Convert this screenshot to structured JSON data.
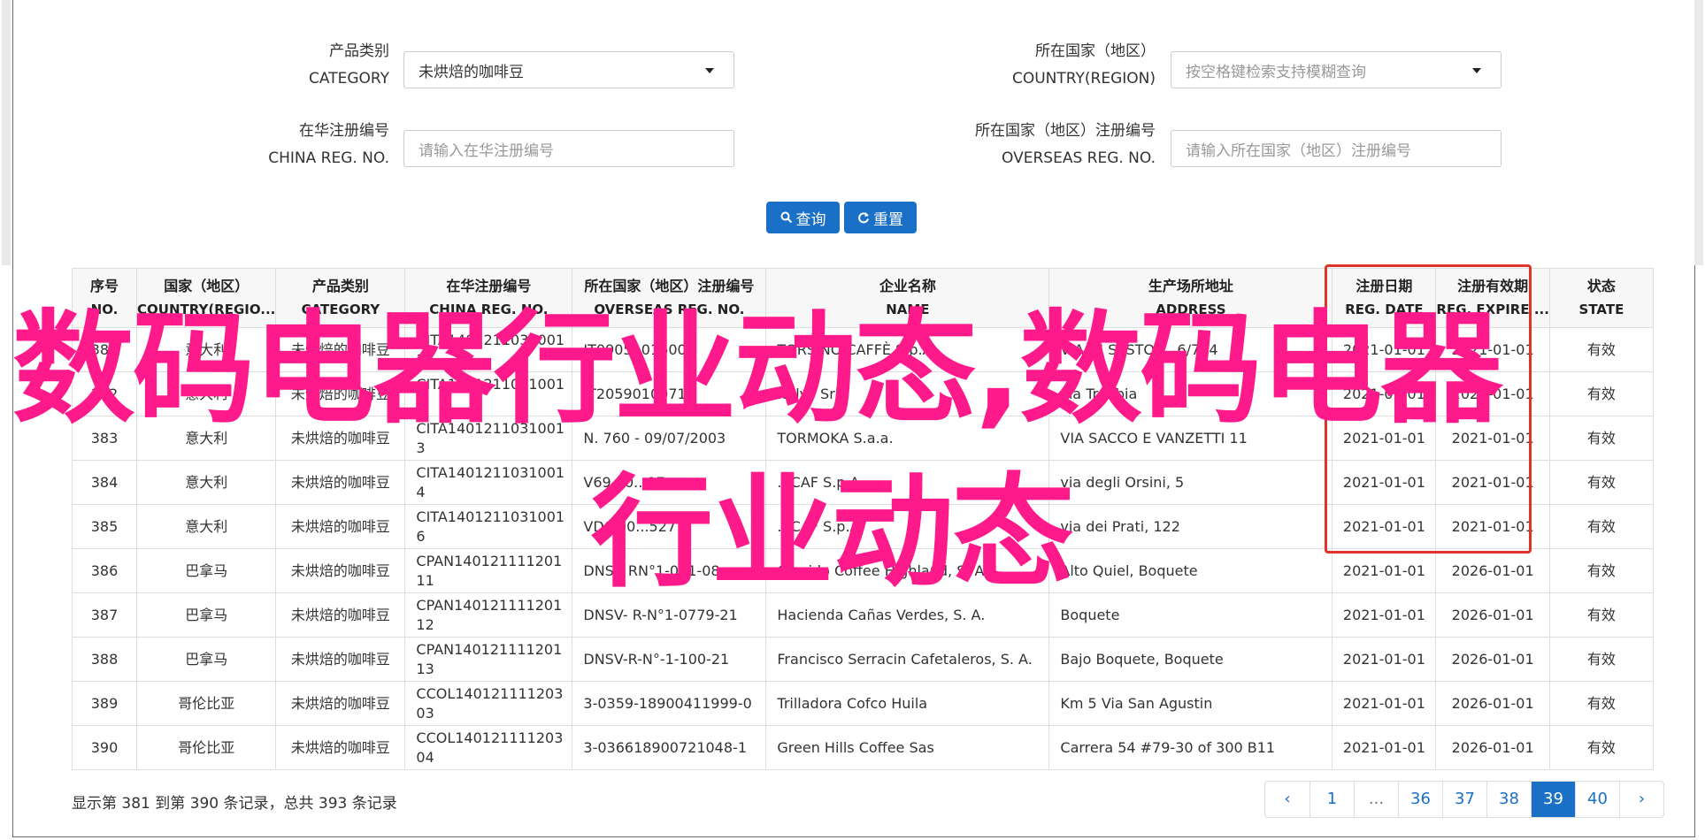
{
  "filters": {
    "category_label_cn": "产品类别",
    "category_label_en": "CATEGORY",
    "category_value": "未烘焙的咖啡豆",
    "country_label_cn": "所在国家（地区）",
    "country_label_en": "COUNTRY(REGION)",
    "country_placeholder": "按空格键检索支持模糊查询",
    "china_reg_label_cn": "在华注册编号",
    "china_reg_label_en": "CHINA REG. NO.",
    "china_reg_placeholder": "请输入在华注册编号",
    "overseas_reg_label_cn": "所在国家（地区）注册编号",
    "overseas_reg_label_en": "OVERSEAS REG. NO.",
    "overseas_reg_placeholder": "请输入所在国家（地区）注册编号",
    "search_button": "查询",
    "reset_button": "重置"
  },
  "table": {
    "headers": [
      {
        "cn": "序号",
        "en": "NO."
      },
      {
        "cn": "国家（地区）",
        "en": "COUNTRY(REGIO..."
      },
      {
        "cn": "产品类别",
        "en": "CATEGORY"
      },
      {
        "cn": "在华注册编号",
        "en": "CHINA REG. NO."
      },
      {
        "cn": "所在国家（地区）注册编号",
        "en": "OVERSEAS REG. NO."
      },
      {
        "cn": "企业名称",
        "en": "NAME"
      },
      {
        "cn": "生产场所地址",
        "en": "ADDRESS"
      },
      {
        "cn": "注册日期",
        "en": "REG. DATE"
      },
      {
        "cn": "注册有效期",
        "en": "REG. EXPIRE ..."
      },
      {
        "cn": "状态",
        "en": "STATE"
      }
    ],
    "rows": [
      {
        "no": "381",
        "country": "意大利",
        "category": "未烘焙的咖啡豆",
        "china_reg": "CITA1401211031001\n1",
        "overseas_reg": "IT09051016001",
        "name": "TORSINO CAFFÈ S.p.A.",
        "address": "VIA DI SESTO ... 6/764",
        "reg_date": "2021-01-01",
        "expire": "2021-01-01",
        "state": "有效"
      },
      {
        "no": "382",
        "country": "意大利",
        "category": "未烘焙的咖啡豆",
        "china_reg": "CITA1401211031001\n2",
        "overseas_reg": "IT20590100718",
        "name": "Italvi' Srl",
        "address": "via Trebbia",
        "reg_date": "2021-01-01",
        "expire": "2021-01-01",
        "state": "有效"
      },
      {
        "no": "383",
        "country": "意大利",
        "category": "未烘焙的咖啡豆",
        "china_reg": "CITA1401211031001\n3",
        "overseas_reg": "N. 760 - 09/07/2003",
        "name": "TORMOKA S.a.a.",
        "address": "VIA SACCO E VANZETTI 11",
        "reg_date": "2021-01-01",
        "expire": "2021-01-01",
        "state": "有效"
      },
      {
        "no": "384",
        "country": "意大利",
        "category": "未烘焙的咖啡豆",
        "china_reg": "CITA1401211031001\n4",
        "overseas_reg": "V69.00...97",
        "name": "...CAF S.p.A.",
        "address": "via degli Orsini, 5",
        "reg_date": "2021-01-01",
        "expire": "2021-01-01",
        "state": "有效"
      },
      {
        "no": "385",
        "country": "意大利",
        "category": "未烘焙的咖啡豆",
        "china_reg": "CITA1401211031001\n6",
        "overseas_reg": "VD6.00...527",
        "name": "...CAF S.p.A.",
        "address": "via dei Prati, 122",
        "reg_date": "2021-01-01",
        "expire": "2021-01-01",
        "state": "有效"
      },
      {
        "no": "386",
        "country": "巴拿马",
        "category": "未烘焙的咖啡豆",
        "china_reg": "CPAN140121111201\n11",
        "overseas_reg": "DNSV RN°1-001-08",
        "name": "Garrido Coffee Highland, S. A.",
        "address": "Alto Quiel, Boquete",
        "reg_date": "2021-01-01",
        "expire": "2026-01-01",
        "state": "有效"
      },
      {
        "no": "387",
        "country": "巴拿马",
        "category": "未烘焙的咖啡豆",
        "china_reg": "CPAN140121111201\n12",
        "overseas_reg": "DNSV- R-N°1-0779-21",
        "name": "Hacienda Cañas Verdes, S. A.",
        "address": "Boquete",
        "reg_date": "2021-01-01",
        "expire": "2026-01-01",
        "state": "有效"
      },
      {
        "no": "388",
        "country": "巴拿马",
        "category": "未烘焙的咖啡豆",
        "china_reg": "CPAN140121111201\n13",
        "overseas_reg": "DNSV-R-N°-1-100-21",
        "name": "Francisco Serracin Cafetaleros, S. A.",
        "address": "Bajo Boquete, Boquete",
        "reg_date": "2021-01-01",
        "expire": "2026-01-01",
        "state": "有效"
      },
      {
        "no": "389",
        "country": "哥伦比亚",
        "category": "未烘焙的咖啡豆",
        "china_reg": "CCOL140121111203\n03",
        "overseas_reg": "3-0359-18900411999-0",
        "name": "Trilladora Cofco Huila",
        "address": "Km 5 Via San Agustin",
        "reg_date": "2021-01-01",
        "expire": "2026-01-01",
        "state": "有效"
      },
      {
        "no": "390",
        "country": "哥伦比亚",
        "category": "未烘焙的咖啡豆",
        "china_reg": "CCOL140121111203\n04",
        "overseas_reg": "3-036618900721048-1",
        "name": "Green Hills Coffee Sas",
        "address": "Carrera 54 #79-30 of 300 B11",
        "reg_date": "2021-01-01",
        "expire": "2026-01-01",
        "state": "有效"
      }
    ]
  },
  "summary": "显示第 381 到第 390 条记录，总共 393 条记录",
  "pagination": {
    "prev": "‹",
    "pages": [
      "1",
      "...",
      "36",
      "37",
      "38",
      "39",
      "40"
    ],
    "active": "39",
    "next": "›"
  },
  "watermark": {
    "line1": "数码电器行业动态,数码电器",
    "line2": "行业动态",
    "color": "#ff1a8c"
  },
  "colors": {
    "primary": "#1a6fc7",
    "highlight_box": "#e0332a"
  }
}
